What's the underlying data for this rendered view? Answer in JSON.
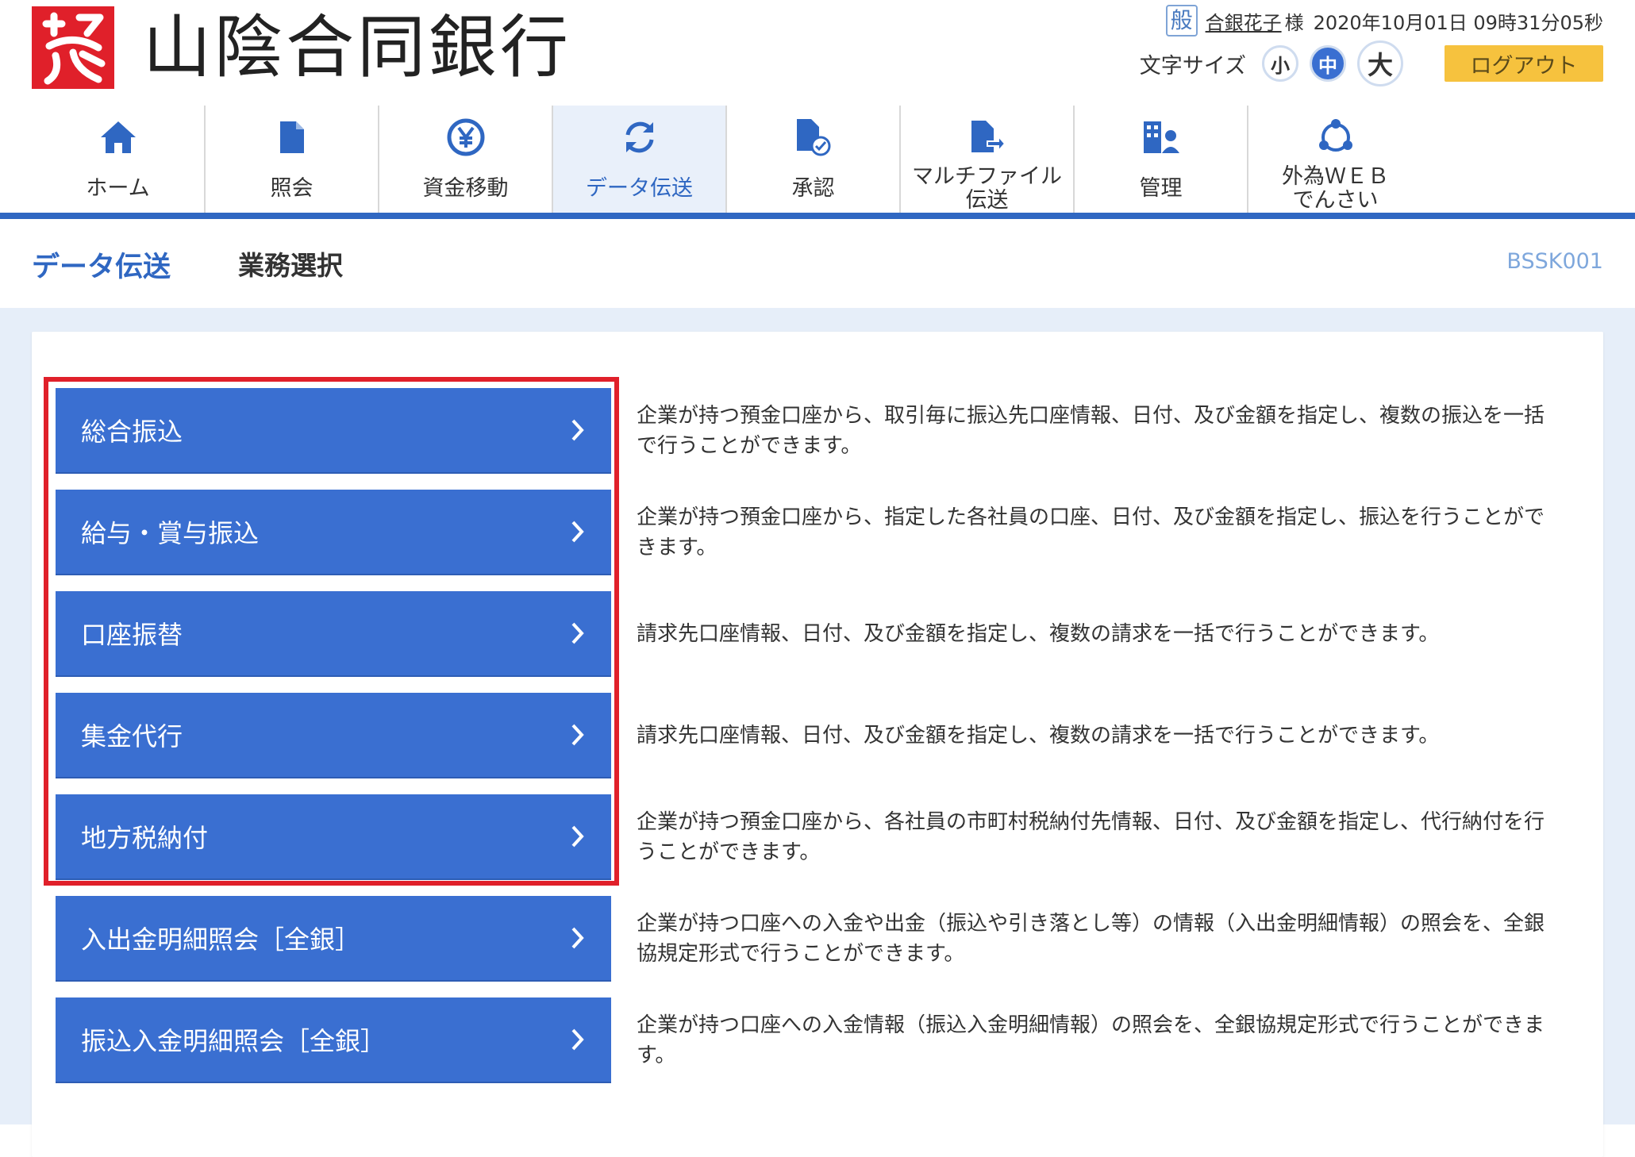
{
  "bank": {
    "name": "山陰合同銀行"
  },
  "user": {
    "badge": "般",
    "name": "合銀花子",
    "honorific": "様",
    "datetime": "2020年10月01日 09時31分05秒"
  },
  "font_size": {
    "label": "文字サイズ",
    "small": "小",
    "medium": "中",
    "large": "大"
  },
  "logout_label": "ログアウト",
  "nav": {
    "active_color": "#2f67c2",
    "items": [
      {
        "label": "ホーム",
        "icon": "home-icon"
      },
      {
        "label": "照会",
        "icon": "document-icon"
      },
      {
        "label": "資金移動",
        "icon": "yen-transfer-icon"
      },
      {
        "label": "データ伝送",
        "icon": "sync-icon",
        "active": true
      },
      {
        "label": "承認",
        "icon": "document-check-icon"
      },
      {
        "label": "マルチファイル\n伝送",
        "icon": "file-send-icon"
      },
      {
        "label": "管理",
        "icon": "admin-icon"
      },
      {
        "label": "外為ＷＥＢ\nでんさい",
        "icon": "network-icon"
      }
    ]
  },
  "page": {
    "title": "データ伝送",
    "subtitle": "業務選択",
    "screen_id": "BSSK001"
  },
  "menu": {
    "button_color": "#3a6fd1",
    "highlight_color": "#e0202a",
    "items": [
      {
        "label": "総合振込",
        "description": "企業が持つ預金口座から、取引毎に振込先口座情報、日付、及び金額を指定し、複数の振込を一括で行うことができます。"
      },
      {
        "label": "給与・賞与振込",
        "description": "企業が持つ預金口座から、指定した各社員の口座、日付、及び金額を指定し、振込を行うことができます。"
      },
      {
        "label": "口座振替",
        "description": "請求先口座情報、日付、及び金額を指定し、複数の請求を一括で行うことができます。"
      },
      {
        "label": "集金代行",
        "description": "請求先口座情報、日付、及び金額を指定し、複数の請求を一括で行うことができます。"
      },
      {
        "label": "地方税納付",
        "description": "企業が持つ預金口座から、各社員の市町村税納付先情報、日付、及び金額を指定し、代行納付を行うことができます。"
      },
      {
        "label": "入出金明細照会［全銀］",
        "description": "企業が持つ口座への入金や出金（振込や引き落とし等）の情報（入出金明細情報）の照会を、全銀協規定形式で行うことができます。"
      },
      {
        "label": "振込入金明細照会［全銀］",
        "description": "企業が持つ口座への入金情報（振込入金明細情報）の照会を、全銀協規定形式で行うことができます。"
      }
    ]
  }
}
